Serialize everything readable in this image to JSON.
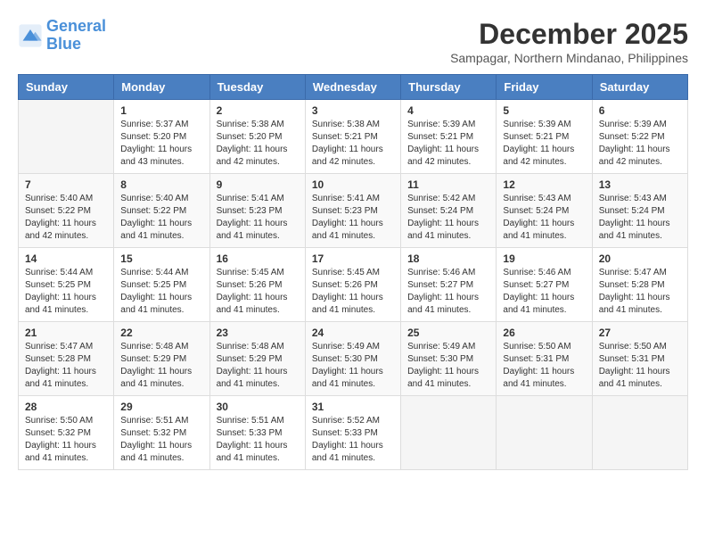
{
  "logo": {
    "line1": "General",
    "line2": "Blue"
  },
  "title": {
    "month_year": "December 2025",
    "location": "Sampagar, Northern Mindanao, Philippines"
  },
  "weekdays": [
    "Sunday",
    "Monday",
    "Tuesday",
    "Wednesday",
    "Thursday",
    "Friday",
    "Saturday"
  ],
  "weeks": [
    [
      {
        "day": "",
        "info": ""
      },
      {
        "day": "1",
        "info": "Sunrise: 5:37 AM\nSunset: 5:20 PM\nDaylight: 11 hours and 43 minutes."
      },
      {
        "day": "2",
        "info": "Sunrise: 5:38 AM\nSunset: 5:20 PM\nDaylight: 11 hours and 42 minutes."
      },
      {
        "day": "3",
        "info": "Sunrise: 5:38 AM\nSunset: 5:21 PM\nDaylight: 11 hours and 42 minutes."
      },
      {
        "day": "4",
        "info": "Sunrise: 5:39 AM\nSunset: 5:21 PM\nDaylight: 11 hours and 42 minutes."
      },
      {
        "day": "5",
        "info": "Sunrise: 5:39 AM\nSunset: 5:21 PM\nDaylight: 11 hours and 42 minutes."
      },
      {
        "day": "6",
        "info": "Sunrise: 5:39 AM\nSunset: 5:22 PM\nDaylight: 11 hours and 42 minutes."
      }
    ],
    [
      {
        "day": "7",
        "info": "Sunrise: 5:40 AM\nSunset: 5:22 PM\nDaylight: 11 hours and 42 minutes."
      },
      {
        "day": "8",
        "info": "Sunrise: 5:40 AM\nSunset: 5:22 PM\nDaylight: 11 hours and 41 minutes."
      },
      {
        "day": "9",
        "info": "Sunrise: 5:41 AM\nSunset: 5:23 PM\nDaylight: 11 hours and 41 minutes."
      },
      {
        "day": "10",
        "info": "Sunrise: 5:41 AM\nSunset: 5:23 PM\nDaylight: 11 hours and 41 minutes."
      },
      {
        "day": "11",
        "info": "Sunrise: 5:42 AM\nSunset: 5:24 PM\nDaylight: 11 hours and 41 minutes."
      },
      {
        "day": "12",
        "info": "Sunrise: 5:43 AM\nSunset: 5:24 PM\nDaylight: 11 hours and 41 minutes."
      },
      {
        "day": "13",
        "info": "Sunrise: 5:43 AM\nSunset: 5:24 PM\nDaylight: 11 hours and 41 minutes."
      }
    ],
    [
      {
        "day": "14",
        "info": "Sunrise: 5:44 AM\nSunset: 5:25 PM\nDaylight: 11 hours and 41 minutes."
      },
      {
        "day": "15",
        "info": "Sunrise: 5:44 AM\nSunset: 5:25 PM\nDaylight: 11 hours and 41 minutes."
      },
      {
        "day": "16",
        "info": "Sunrise: 5:45 AM\nSunset: 5:26 PM\nDaylight: 11 hours and 41 minutes."
      },
      {
        "day": "17",
        "info": "Sunrise: 5:45 AM\nSunset: 5:26 PM\nDaylight: 11 hours and 41 minutes."
      },
      {
        "day": "18",
        "info": "Sunrise: 5:46 AM\nSunset: 5:27 PM\nDaylight: 11 hours and 41 minutes."
      },
      {
        "day": "19",
        "info": "Sunrise: 5:46 AM\nSunset: 5:27 PM\nDaylight: 11 hours and 41 minutes."
      },
      {
        "day": "20",
        "info": "Sunrise: 5:47 AM\nSunset: 5:28 PM\nDaylight: 11 hours and 41 minutes."
      }
    ],
    [
      {
        "day": "21",
        "info": "Sunrise: 5:47 AM\nSunset: 5:28 PM\nDaylight: 11 hours and 41 minutes."
      },
      {
        "day": "22",
        "info": "Sunrise: 5:48 AM\nSunset: 5:29 PM\nDaylight: 11 hours and 41 minutes."
      },
      {
        "day": "23",
        "info": "Sunrise: 5:48 AM\nSunset: 5:29 PM\nDaylight: 11 hours and 41 minutes."
      },
      {
        "day": "24",
        "info": "Sunrise: 5:49 AM\nSunset: 5:30 PM\nDaylight: 11 hours and 41 minutes."
      },
      {
        "day": "25",
        "info": "Sunrise: 5:49 AM\nSunset: 5:30 PM\nDaylight: 11 hours and 41 minutes."
      },
      {
        "day": "26",
        "info": "Sunrise: 5:50 AM\nSunset: 5:31 PM\nDaylight: 11 hours and 41 minutes."
      },
      {
        "day": "27",
        "info": "Sunrise: 5:50 AM\nSunset: 5:31 PM\nDaylight: 11 hours and 41 minutes."
      }
    ],
    [
      {
        "day": "28",
        "info": "Sunrise: 5:50 AM\nSunset: 5:32 PM\nDaylight: 11 hours and 41 minutes."
      },
      {
        "day": "29",
        "info": "Sunrise: 5:51 AM\nSunset: 5:32 PM\nDaylight: 11 hours and 41 minutes."
      },
      {
        "day": "30",
        "info": "Sunrise: 5:51 AM\nSunset: 5:33 PM\nDaylight: 11 hours and 41 minutes."
      },
      {
        "day": "31",
        "info": "Sunrise: 5:52 AM\nSunset: 5:33 PM\nDaylight: 11 hours and 41 minutes."
      },
      {
        "day": "",
        "info": ""
      },
      {
        "day": "",
        "info": ""
      },
      {
        "day": "",
        "info": ""
      }
    ]
  ]
}
